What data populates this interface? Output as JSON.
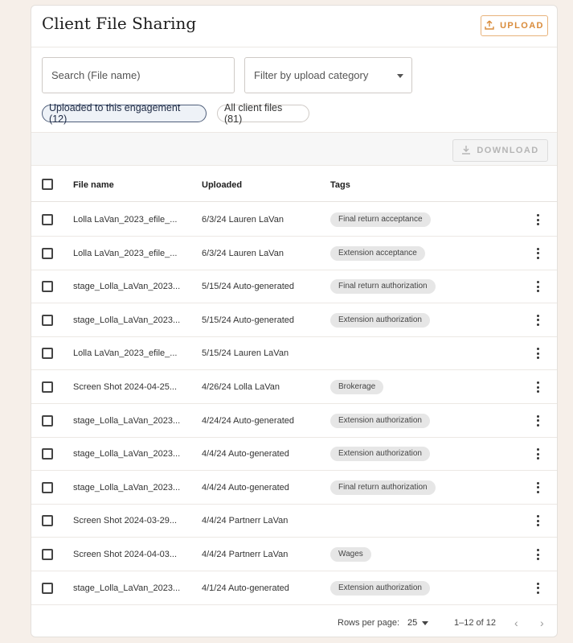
{
  "header": {
    "title": "Client File Sharing",
    "upload_label": "UPLOAD"
  },
  "search": {
    "placeholder": "Search (File name)"
  },
  "filter": {
    "placeholder": "Filter by upload category"
  },
  "chips": {
    "engagement": "Uploaded to this engagement (12)",
    "all": "All client files (81)"
  },
  "toolbar": {
    "download_label": "DOWNLOAD"
  },
  "table": {
    "columns": {
      "file": "File name",
      "uploaded": "Uploaded",
      "tags": "Tags"
    },
    "rows": [
      {
        "file": "Lolla LaVan_2023_efile_...",
        "uploaded": "6/3/24 Lauren LaVan",
        "tag": "Final return acceptance"
      },
      {
        "file": "Lolla LaVan_2023_efile_...",
        "uploaded": "6/3/24 Lauren LaVan",
        "tag": "Extension acceptance"
      },
      {
        "file": "stage_Lolla_LaVan_2023...",
        "uploaded": "5/15/24 Auto-generated",
        "tag": "Final return authorization"
      },
      {
        "file": "stage_Lolla_LaVan_2023...",
        "uploaded": "5/15/24 Auto-generated",
        "tag": "Extension authorization"
      },
      {
        "file": "Lolla LaVan_2023_efile_...",
        "uploaded": "5/15/24 Lauren LaVan",
        "tag": ""
      },
      {
        "file": "Screen Shot 2024-04-25...",
        "uploaded": "4/26/24 Lolla LaVan",
        "tag": "Brokerage"
      },
      {
        "file": "stage_Lolla_LaVan_2023...",
        "uploaded": "4/24/24 Auto-generated",
        "tag": "Extension authorization"
      },
      {
        "file": "stage_Lolla_LaVan_2023...",
        "uploaded": "4/4/24 Auto-generated",
        "tag": "Extension authorization"
      },
      {
        "file": "stage_Lolla_LaVan_2023...",
        "uploaded": "4/4/24 Auto-generated",
        "tag": "Final return authorization"
      },
      {
        "file": "Screen Shot 2024-03-29...",
        "uploaded": "4/4/24 Partnerr LaVan",
        "tag": ""
      },
      {
        "file": "Screen Shot 2024-04-03...",
        "uploaded": "4/4/24 Partnerr LaVan",
        "tag": "Wages"
      },
      {
        "file": "stage_Lolla_LaVan_2023...",
        "uploaded": "4/1/24 Auto-generated",
        "tag": "Extension authorization"
      }
    ]
  },
  "footer": {
    "rows_per_page_label": "Rows per page:",
    "rows_per_page": "25",
    "range": "1–12 of 12"
  },
  "icons": {
    "upload": "upload-icon",
    "download": "download-icon",
    "prev": "chevron-left-icon",
    "next": "chevron-right-icon",
    "menu": "more-vertical-icon"
  },
  "colors": {
    "accent": "#d98b3a",
    "chip_border": "#4f5e7a"
  }
}
